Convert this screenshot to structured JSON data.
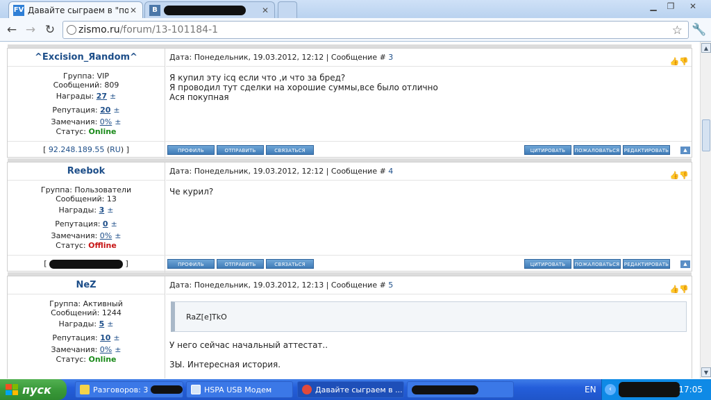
{
  "browser": {
    "tabs": [
      {
        "title": "Давайте сыграем в \"поймай м",
        "favicon": "FV"
      },
      {
        "title": "",
        "favicon": "B"
      }
    ],
    "url_host": "zismo.ru",
    "url_path": "/forum/13-101184-1"
  },
  "labels": {
    "date_prefix": "Дата:",
    "msg_prefix": "| Сообщение #",
    "group": "Группа:",
    "messages": "Сообщений:",
    "awards": "Награды:",
    "reputation": "Репутация:",
    "warnings": "Замечания:",
    "status": "Статус:",
    "plus": "±"
  },
  "buttons": {
    "profile": "ПРОФИЛЬ",
    "send": "ОТПРАВИТЬ",
    "contact": "СВЯЗАТЬСЯ",
    "quote": "ЦИТИРОВАТЬ",
    "complain": "ПОЖАЛОВАТЬСЯ",
    "edit": "РЕДАКТИРОВАТЬ"
  },
  "posts": [
    {
      "author": "^Excision_Яandom^",
      "group": "VIP",
      "messages": "809",
      "awards": "27",
      "reputation": "20",
      "warnings": "0%",
      "status": "Online",
      "date": "Понедельник, 19.03.2012, 12:12",
      "num": "3",
      "body": [
        "Я купил эту icq если что ,и что за бред?",
        "Я проводил тут сделки на хорошие суммы,все было отлично",
        "Ася покупная"
      ],
      "ip": "92.248.189.55",
      "ip_country": "RU"
    },
    {
      "author": "Reebok",
      "group": "Пользователи",
      "messages": "13",
      "awards": "3",
      "reputation": "0",
      "warnings": "0%",
      "status": "Offline",
      "date": "Понедельник, 19.03.2012, 12:12",
      "num": "4",
      "body": [
        "Че курил?"
      ]
    },
    {
      "author": "NeZ",
      "group": "Активный",
      "messages": "1244",
      "awards": "5",
      "reputation": "10",
      "warnings": "0%",
      "status": "Online",
      "date": "Понедельник, 19.03.2012, 12:13",
      "num": "5",
      "quote": "RaZ[e]TkO",
      "body": [
        "У него сейчас начальный аттестат..",
        "3Ы. Интересная история."
      ]
    }
  ],
  "taskbar": {
    "start": "пуск",
    "items": [
      "Разговоров: 3",
      "HSPA USB Модем",
      "Давайте сыграем в ..."
    ],
    "lang": "EN",
    "clock": "17:05"
  }
}
